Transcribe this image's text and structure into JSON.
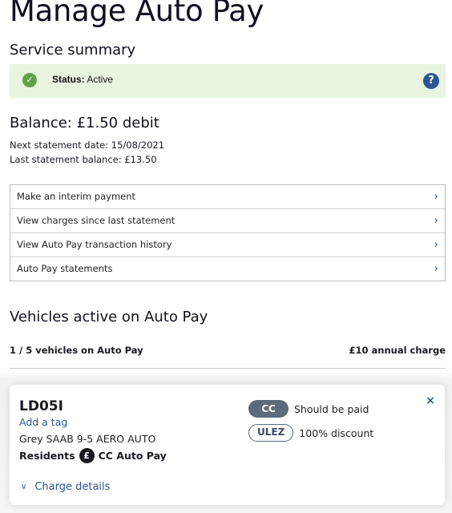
{
  "page": {
    "title": "Manage Auto Pay"
  },
  "service_summary": {
    "title": "Service summary",
    "status_label": "Status:",
    "status_value": "Active",
    "status_icon": "check-circle-icon",
    "help_icon": "question-circle-icon",
    "colors": {
      "panel_bg": "#eaf5e1",
      "check": "#5ea24a",
      "help": "#2d5592"
    }
  },
  "balance": {
    "heading": "Balance: £1.50 debit",
    "next_statement": "Next statement date: 15/08/2021",
    "last_statement": "Last statement balance: £13.50"
  },
  "menu": {
    "items": [
      {
        "label": "Make an interim payment",
        "icon": "chevron-right-icon"
      },
      {
        "label": "View charges since last statement",
        "icon": "chevron-right-icon"
      },
      {
        "label": "View Auto Pay transaction history",
        "icon": "chevron-right-icon"
      },
      {
        "label": "Auto Pay statements",
        "icon": "chevron-right-icon"
      }
    ]
  },
  "vehicles": {
    "title": "Vehicles active on Auto Pay",
    "count": "1 / 5 vehicles on Auto Pay",
    "annual_charge": "£10 annual charge",
    "list": [
      {
        "plate": "LD05I",
        "add_tag": "Add a tag",
        "description": "Grey SAAB 9-5 AERO AUTO",
        "residents_label": "Residents",
        "pound_icon": "£",
        "scheme": "CC Auto Pay",
        "charges": [
          {
            "badge": "CC",
            "style": "filled",
            "text": "Should be paid"
          },
          {
            "badge": "ULEZ",
            "style": "outline",
            "text": "100% discount"
          }
        ],
        "close_icon": "×",
        "charge_details": "Charge details",
        "chevron": "⌄"
      }
    ]
  },
  "glyphs": {
    "check": "✓",
    "question": "?",
    "chevron_right": "›",
    "chevron_down": "∨"
  }
}
